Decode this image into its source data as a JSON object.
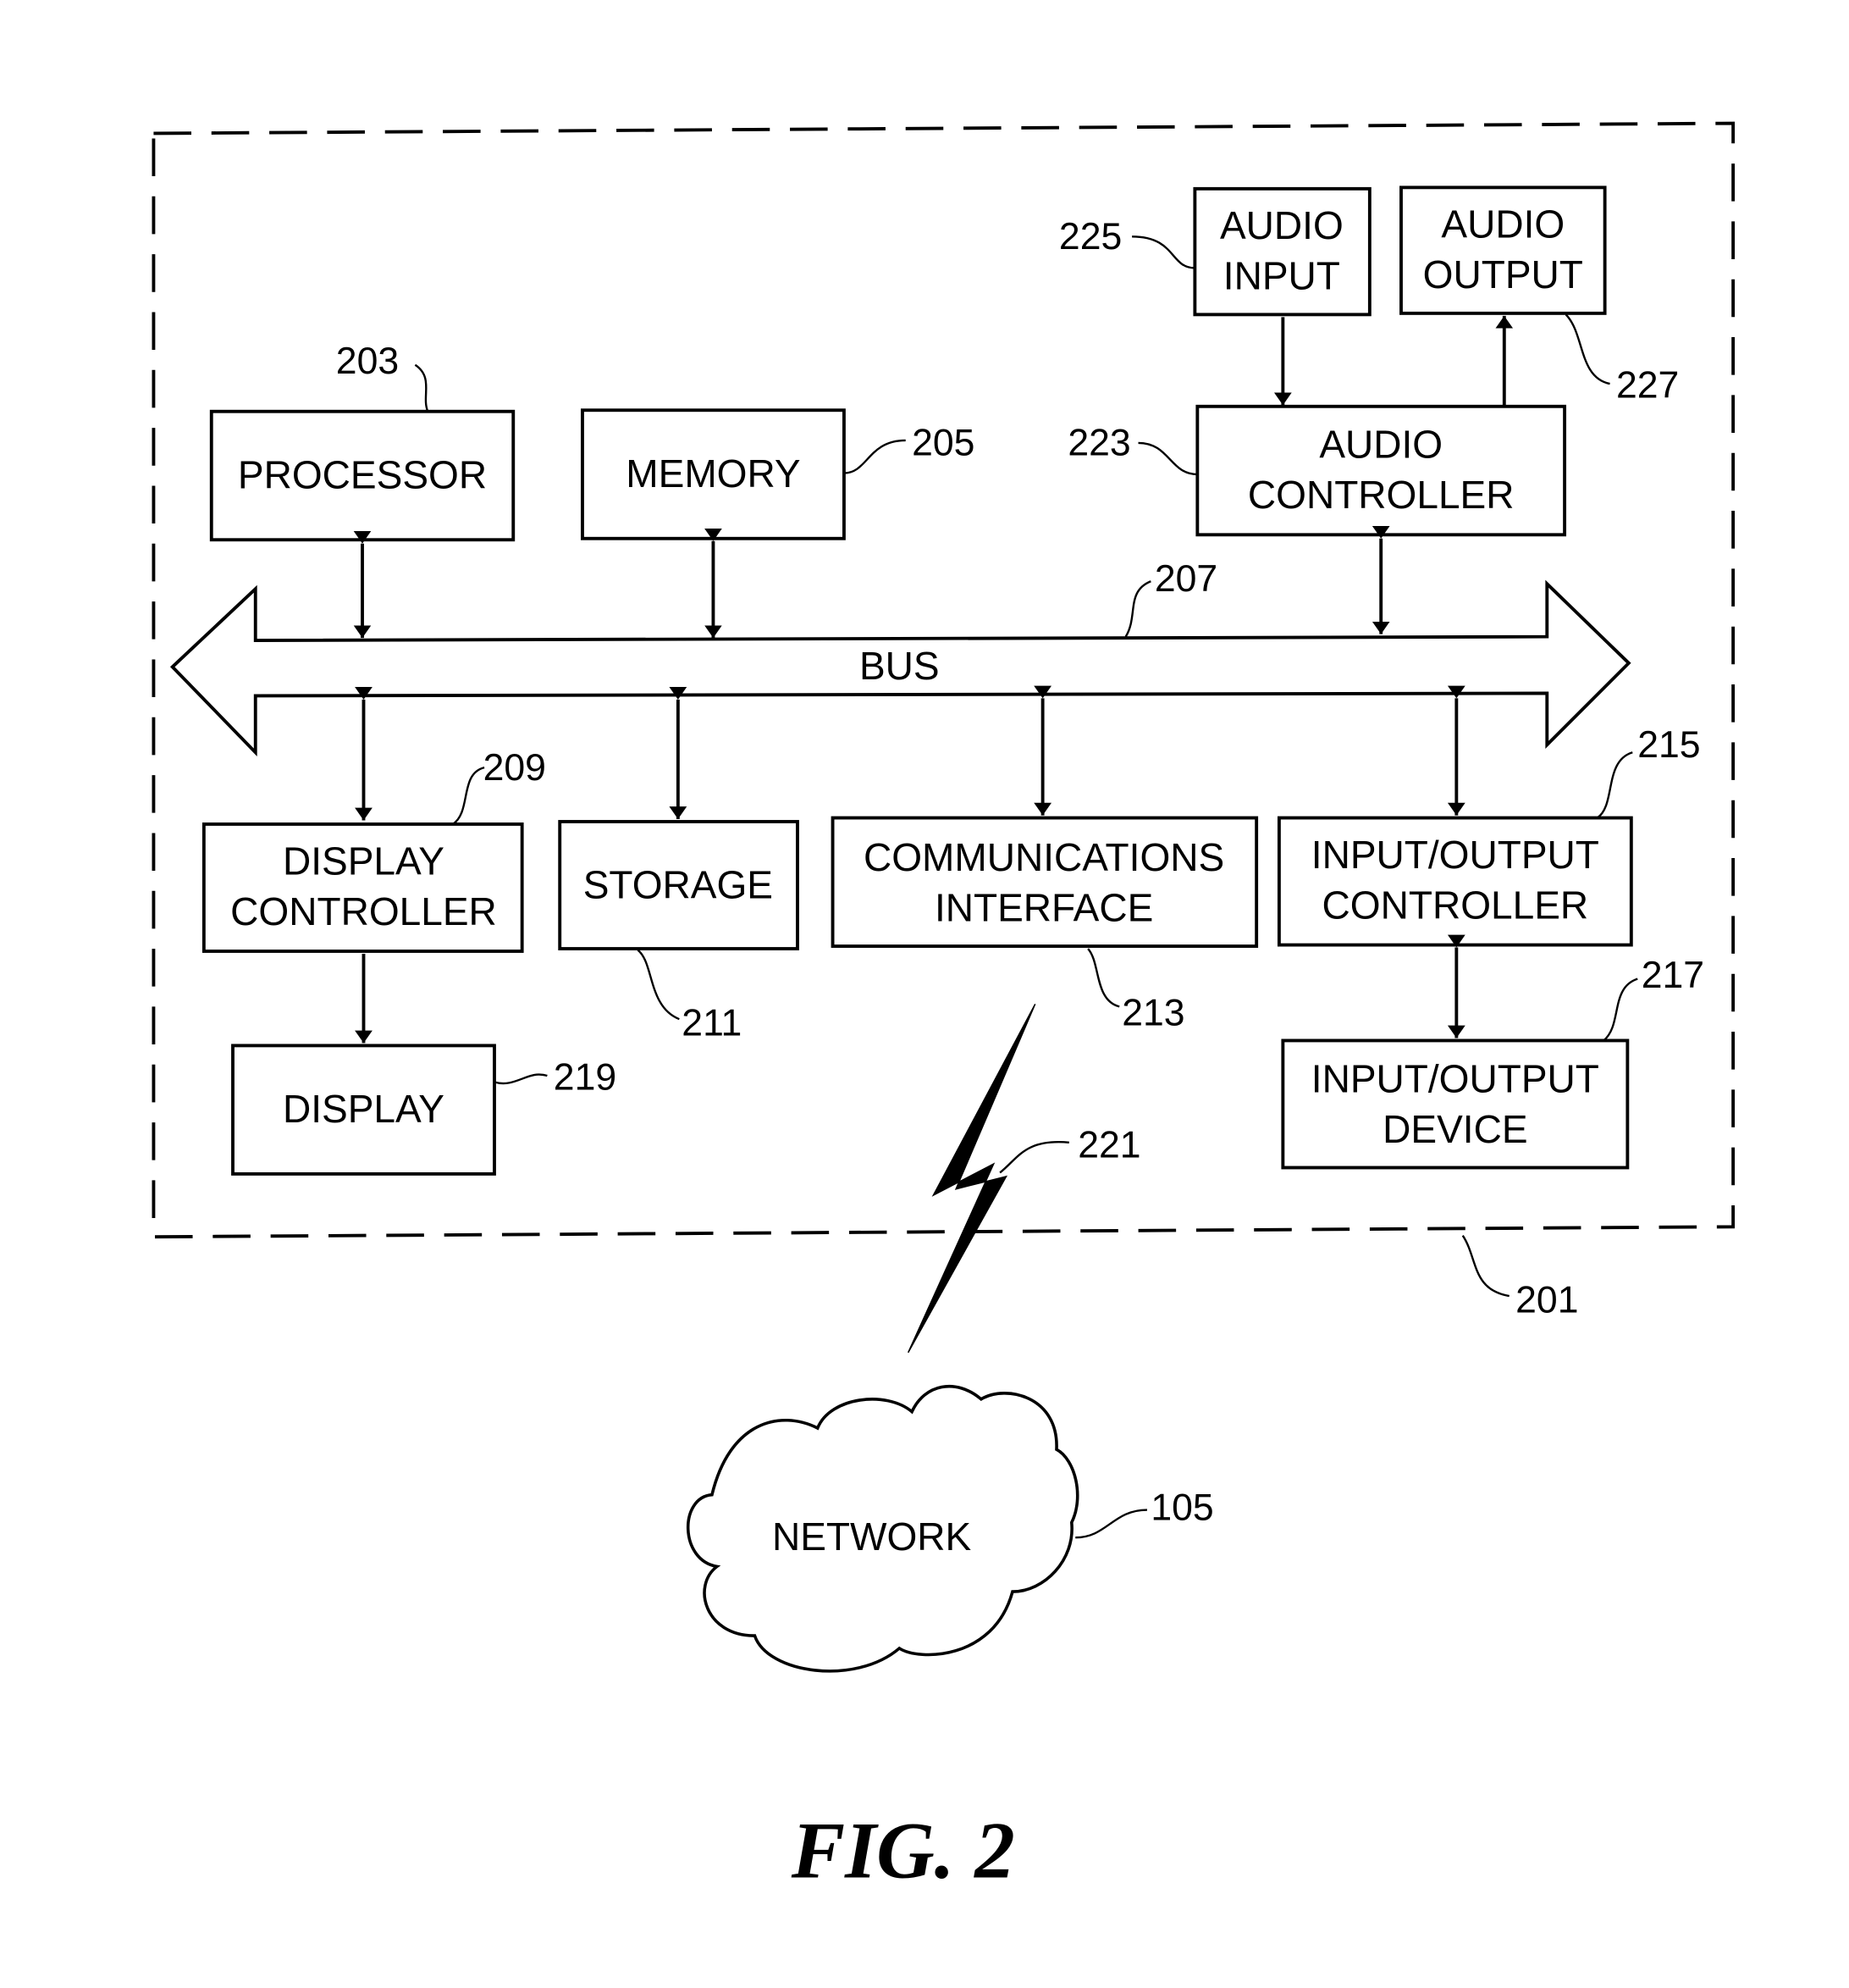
{
  "figure": {
    "caption": "FIG. 2"
  },
  "components": {
    "processor": {
      "label": "PROCESSOR",
      "ref": "203"
    },
    "memory": {
      "label": "MEMORY",
      "ref": "205"
    },
    "bus": {
      "label": "BUS",
      "ref": "207"
    },
    "display_controller": {
      "line1": "DISPLAY",
      "line2": "CONTROLLER",
      "ref": "209"
    },
    "storage": {
      "label": "STORAGE",
      "ref": "211"
    },
    "communications_interface": {
      "line1": "COMMUNICATIONS",
      "line2": "INTERFACE",
      "ref": "213"
    },
    "io_controller": {
      "line1": "INPUT/OUTPUT",
      "line2": "CONTROLLER",
      "ref": "215"
    },
    "io_device": {
      "line1": "INPUT/OUTPUT",
      "line2": "DEVICE",
      "ref": "217"
    },
    "display": {
      "label": "DISPLAY",
      "ref": "219"
    },
    "wireless_link": {
      "ref": "221"
    },
    "audio_controller": {
      "line1": "AUDIO",
      "line2": "CONTROLLER",
      "ref": "223"
    },
    "audio_input": {
      "line1": "AUDIO",
      "line2": "INPUT",
      "ref": "225"
    },
    "audio_output": {
      "line1": "AUDIO",
      "line2": "OUTPUT",
      "ref": "227"
    },
    "device": {
      "ref": "201"
    },
    "network": {
      "label": "NETWORK",
      "ref": "105"
    }
  }
}
